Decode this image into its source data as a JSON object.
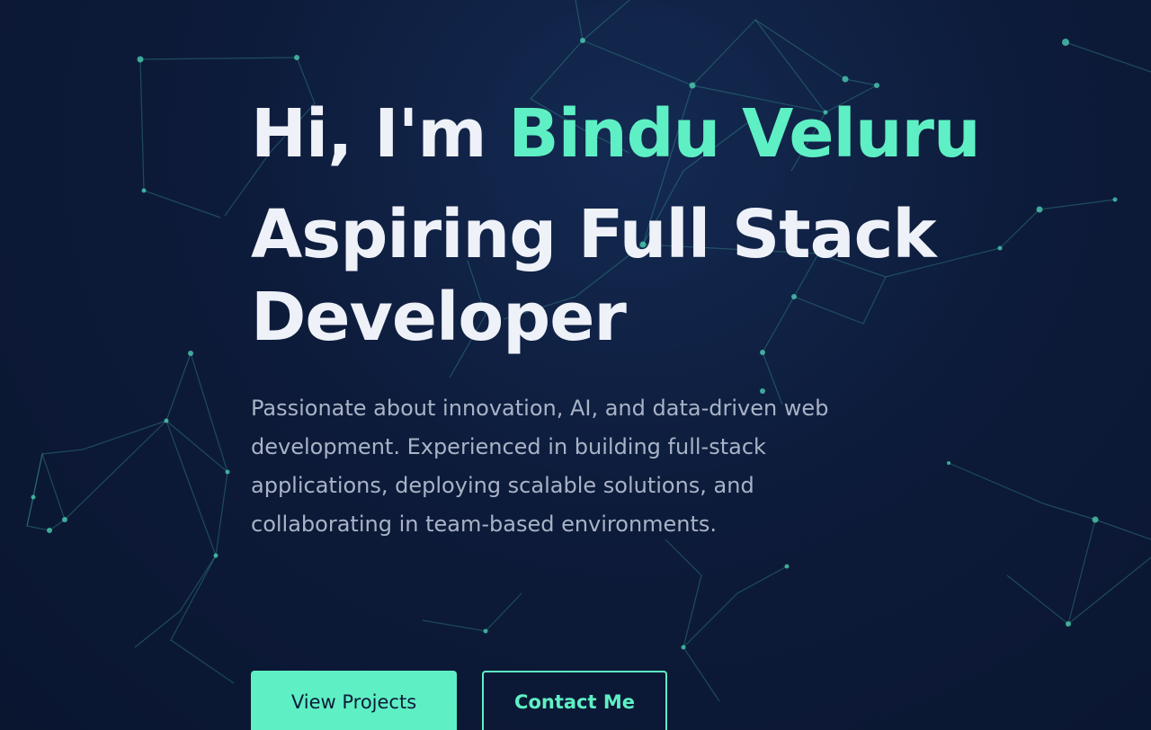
{
  "hero": {
    "greeting_prefix": "Hi, I'm ",
    "name": "Bindu Veluru",
    "role": "Aspiring Full Stack Developer",
    "description": "Passionate about innovation, AI, and data-driven web development. Experienced in building full-stack applications, deploying scalable solutions, and collaborating in team-based environments."
  },
  "actions": {
    "primary_label": "View Projects",
    "secondary_label": "Contact Me"
  },
  "colors": {
    "background": "#0d1b3a",
    "accent": "#5ef0c4",
    "heading": "#eef1f8",
    "body_text": "#a9b3c6"
  }
}
